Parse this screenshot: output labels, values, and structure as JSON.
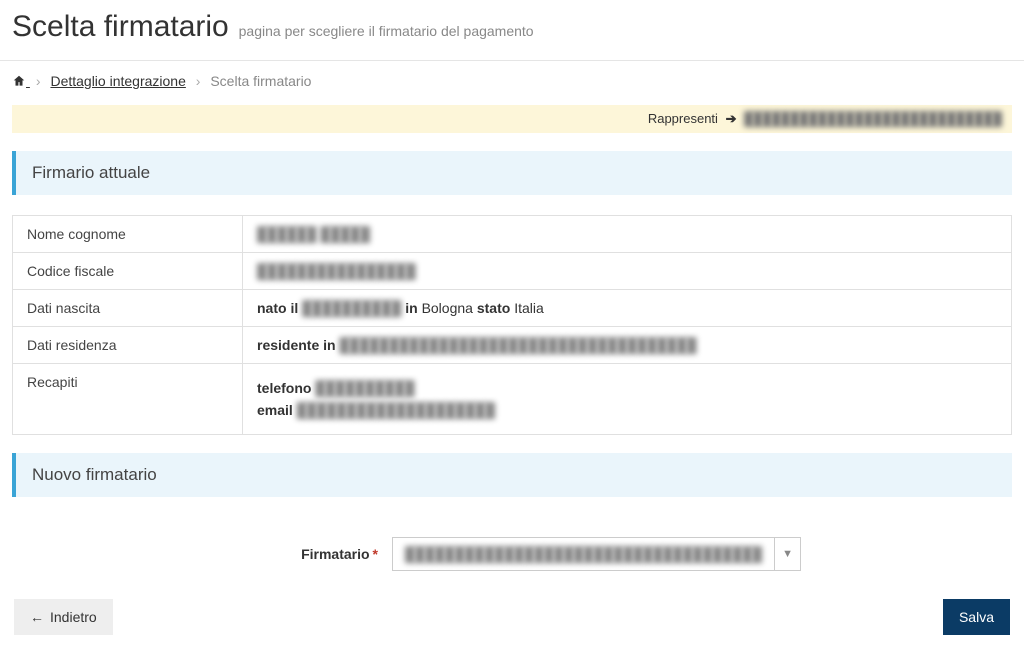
{
  "header": {
    "title": "Scelta firmatario",
    "subtitle": "pagina per scegliere il firmatario del pagamento"
  },
  "breadcrumb": {
    "home_label": "Home",
    "link1": "Dettaglio integrazione",
    "current": "Scelta firmatario"
  },
  "represent": {
    "label": "Rappresenti",
    "value": "████████████████████████████"
  },
  "section_firmario": {
    "title": "Firmario attuale",
    "rows": {
      "nome_cognome_label": "Nome cognome",
      "nome_cognome_value": "██████ █████",
      "codice_fiscale_label": "Codice fiscale",
      "codice_fiscale_value": "████████████████",
      "dati_nascita_label": "Dati nascita",
      "dati_nascita_prefix": "nato il",
      "dati_nascita_date": "██████████",
      "dati_nascita_in": "in",
      "dati_nascita_city": "Bologna",
      "dati_nascita_stato_label": "stato",
      "dati_nascita_stato_value": "Italia",
      "dati_residenza_label": "Dati residenza",
      "dati_residenza_prefix": "residente in",
      "dati_residenza_value": "████████████████████████████████████",
      "recapiti_label": "Recapiti",
      "telefono_label": "telefono",
      "telefono_value": "██████████",
      "email_label": "email",
      "email_value": "████████████████████"
    }
  },
  "section_nuovo": {
    "title": "Nuovo firmatario",
    "form": {
      "firmatario_label": "Firmatario",
      "firmatario_selected": "████████████████████████████████████"
    }
  },
  "actions": {
    "back": "Indietro",
    "save": "Salva"
  }
}
